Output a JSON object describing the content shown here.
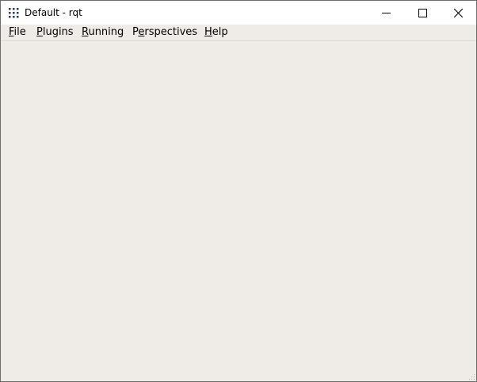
{
  "window": {
    "title": "Default - rqt",
    "icon": "rqt-grid-icon"
  },
  "window_controls": {
    "minimize": "minimize-icon",
    "maximize": "maximize-icon",
    "close": "close-icon"
  },
  "menubar": {
    "items": [
      {
        "pre": "",
        "acc": "F",
        "post": "ile"
      },
      {
        "pre": "",
        "acc": "P",
        "post": "lugins"
      },
      {
        "pre": "",
        "acc": "R",
        "post": "unning"
      },
      {
        "pre": "P",
        "acc": "e",
        "post": "rspectives"
      },
      {
        "pre": "",
        "acc": "H",
        "post": "elp"
      }
    ]
  },
  "colors": {
    "titlebar": "#ffffff",
    "body": "#efebe7",
    "icon": "#2b3a67"
  }
}
